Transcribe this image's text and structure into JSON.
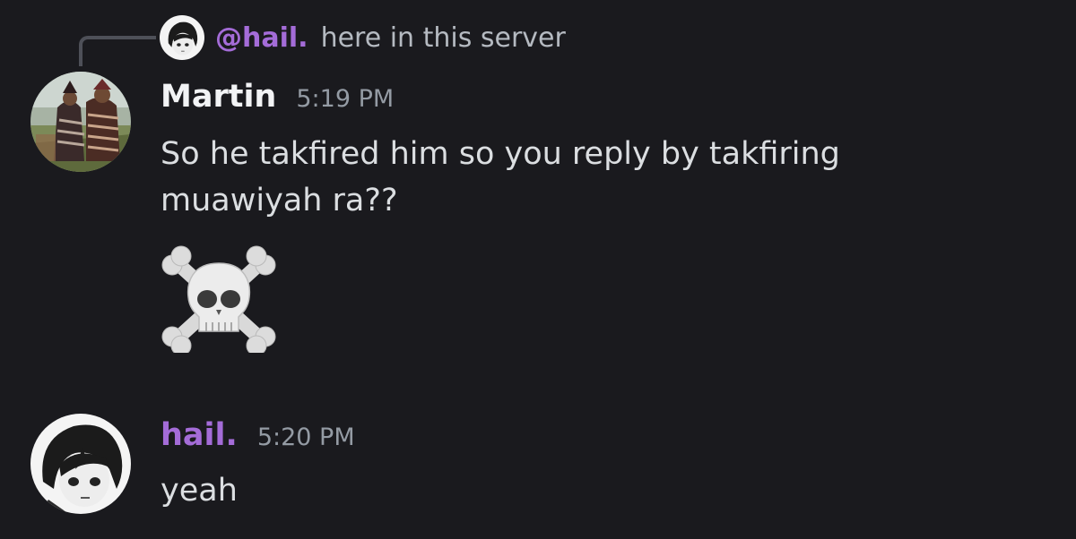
{
  "reply": {
    "author": "@hail.",
    "text": "here in this server"
  },
  "messages": [
    {
      "author": "Martin",
      "time": "5:19 PM",
      "lines": [
        "So he takfired him so you reply by takfiring",
        "muawiyah ra??"
      ],
      "emoji": "skull-and-crossbones"
    },
    {
      "author": "hail.",
      "time": "5:20 PM",
      "lines": [
        "yeah"
      ]
    }
  ],
  "colors": {
    "background": "#1a1a1e",
    "hail_name": "#a46cd8",
    "timestamp": "#949ba4",
    "message_text": "#dbdee1"
  }
}
